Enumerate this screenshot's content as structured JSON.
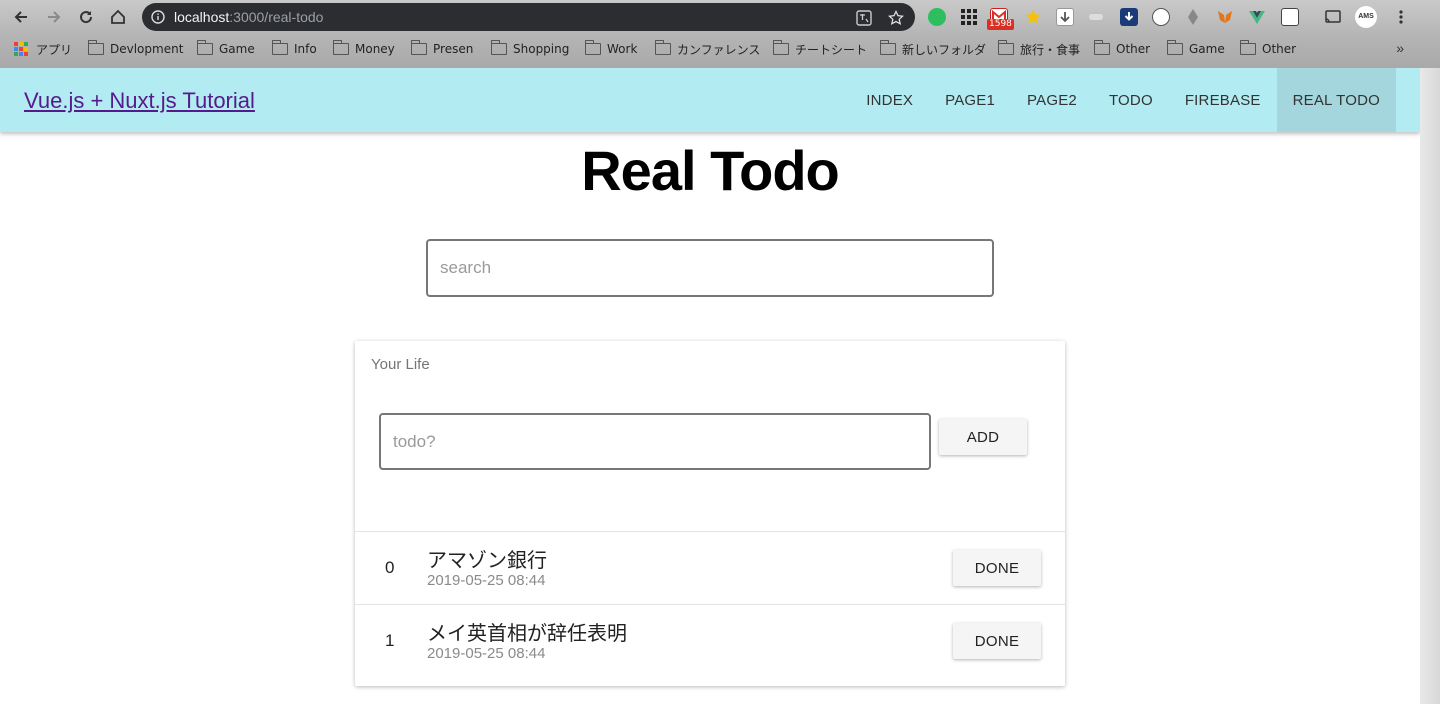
{
  "browser": {
    "url_host": "localhost",
    "url_rest": ":3000/real-todo",
    "mail_badge": "1598",
    "ext_avatar": "AMS",
    "bookmarks": [
      "アプリ",
      "Devlopment",
      "Game",
      "Info",
      "Money",
      "Presen",
      "Shopping",
      "Work",
      "カンファレンス",
      "チートシート",
      "新しいフォルダ",
      "旅行・食事",
      "Other",
      "Game",
      "Other"
    ],
    "more": "»"
  },
  "appbar": {
    "brand": "Vue.js + Nuxt.js Tutorial",
    "menu": [
      "INDEX",
      "PAGE1",
      "PAGE2",
      "TODO",
      "FIREBASE",
      "REAL TODO"
    ],
    "active": "REAL TODO",
    "color": "#b2ebf2"
  },
  "page": {
    "title": "Real Todo",
    "search_placeholder": "search"
  },
  "card": {
    "title": "Your Life",
    "input_placeholder": "todo?",
    "add_label": "ADD",
    "items": [
      {
        "index": "0",
        "text": "アマゾン銀行",
        "date": "2019-05-25 08:44",
        "button": "DONE"
      },
      {
        "index": "1",
        "text": "メイ英首相が辞任表明",
        "date": "2019-05-25 08:44",
        "button": "DONE"
      }
    ]
  }
}
